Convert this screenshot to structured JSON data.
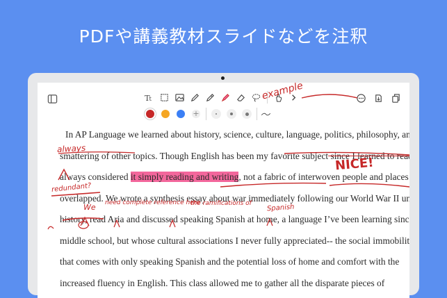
{
  "headline": "PDFや講義教材スライドなどを注釈",
  "toolbar": {
    "tools": [
      "text-tool",
      "crop-tool",
      "image-tool",
      "pen-tool",
      "pencil-tool",
      "highlighter-tool",
      "eraser-tool",
      "lasso-tool",
      "touch-tool",
      "more-chevron"
    ],
    "colors": [
      "#c62828",
      "#f5a623",
      "#3b7ff5"
    ],
    "add_color": "+"
  },
  "document": {
    "lines": [
      "In AP Language we learned about history, science, culture, language, politics, philosophy, and a",
      "smattering of other topics. Though English has been my favorite subject",
      "always considered",
      "it simply reading and writing",
      ", not a fabric of interwoven people and places that",
      "overlapped. We wrote a synthesis essay about war immediately following our World War II unit in",
      "history, read Aria and discussed speaking Spanish at home, a language I’ve been learning since",
      "middle school, but whose cultural associations I never fully appreciated-- the social immobility",
      "that comes with only speaking Spanish and the potential loss of home and comfort with the",
      "increased fluency in English. This class allowed me to gather all the disparate pieces of"
    ],
    "struck_text": " since I learned to read, I"
  },
  "annotations": {
    "always": "always",
    "nice": "NICE!",
    "redundant": "redundant?",
    "we": "We",
    "need_ref": "need complete reference here",
    "ramifications": "the ramifications of",
    "spanish": "Spanish",
    "example": "example"
  }
}
